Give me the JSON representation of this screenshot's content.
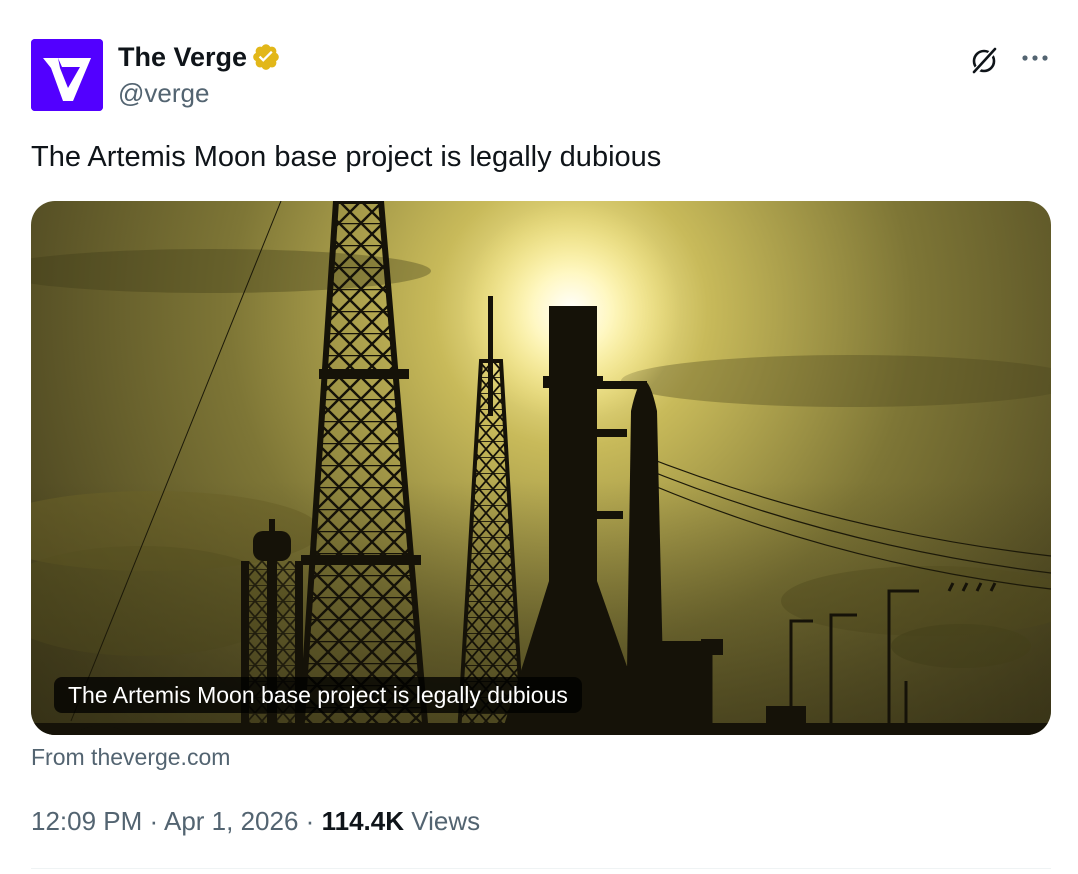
{
  "author": {
    "display_name": "The Verge",
    "handle": "@verge",
    "verified": true,
    "avatar_icon": "verge-logo-icon",
    "avatar_color": "#5200ff",
    "verified_color": "#e2b719"
  },
  "header_actions": {
    "grok_icon": "grok-icon",
    "more_icon": "more-options-icon"
  },
  "tweet": {
    "text": "The Artemis Moon base project is legally dubious"
  },
  "link_card": {
    "image_subject": "Artemis rocket on launch pad silhouetted against sun",
    "headline": "The Artemis Moon base project is legally dubious",
    "source_text": "From theverge.com"
  },
  "meta": {
    "time": "12:09 PM",
    "separator": "·",
    "date": "Apr 1, 2026",
    "views_count": "114.4K",
    "views_label": "Views"
  },
  "colors": {
    "text_primary": "#0f1419",
    "text_secondary": "#536471",
    "divider": "#eff3f4"
  }
}
